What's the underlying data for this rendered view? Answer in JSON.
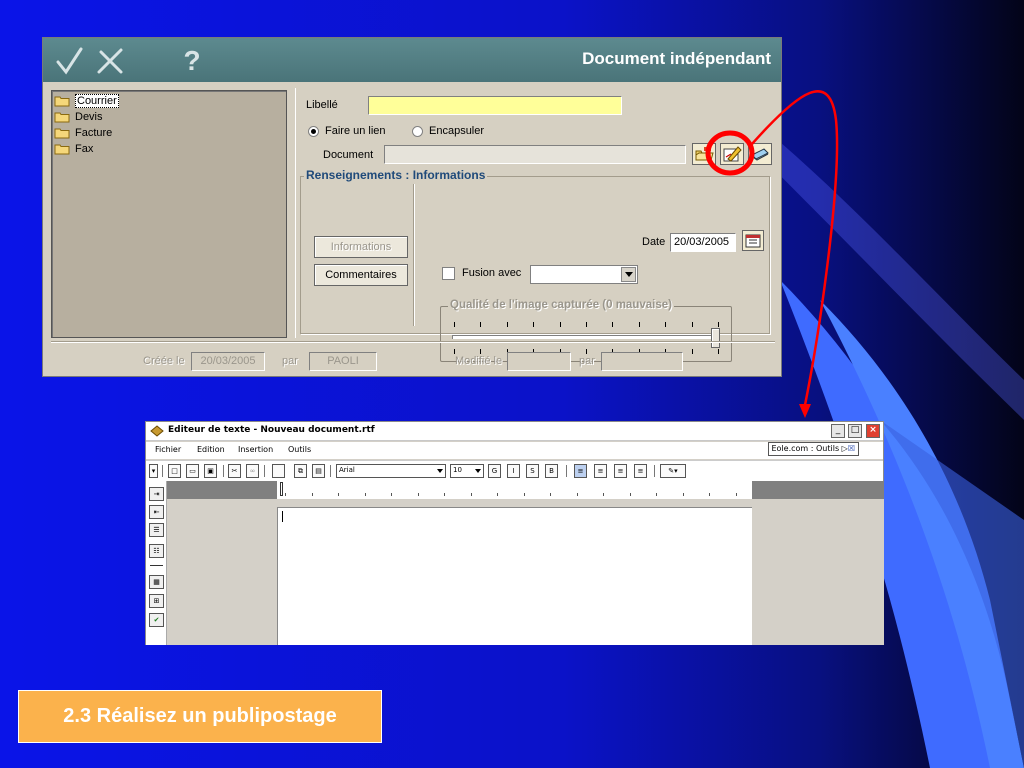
{
  "dialog": {
    "title": "Document indépendant",
    "toolbar": {
      "ok_icon": "checkmark-icon",
      "cancel_icon": "cross-icon",
      "help_label": "?"
    },
    "folders": [
      "Courrier",
      "Devis",
      "Facture",
      "Fax"
    ],
    "selected_folder": "Courrier",
    "libelle_label": "Libellé",
    "libelle_value": "",
    "radio_lien_label": "Faire un lien",
    "radio_encapsuler_label": "Encapsuler",
    "radio_selected": "Faire un lien",
    "document_label": "Document",
    "document_value": "",
    "group_title": "Renseignements : Informations",
    "btn_informations": "Informations",
    "btn_commentaires": "Commentaires",
    "date_label": "Date",
    "date_value": "20/03/2005",
    "fusion_label": "Fusion avec",
    "fusion_value": "",
    "quality_title": "Qualité de l'image capturée (0 mauvaise)",
    "quality_level": 1.0,
    "footer": {
      "cree_label": "Créée le",
      "cree_value": "20/03/2005",
      "par1_label": "par",
      "par1_value": "PAOLI",
      "modifie_label": "Modifié le",
      "modifie_value": "",
      "par2_label": "par",
      "par2_value": ""
    },
    "highlight_color": "#ff0000"
  },
  "editor": {
    "title": "Editeur de texte - Nouveau document.rtf",
    "menu": [
      "Fichier",
      "Edition",
      "Insertion",
      "Outils"
    ],
    "eole_label": "Eole.com : Outils",
    "font_value": "Arial",
    "size_value": "10",
    "format_buttons": [
      "G",
      "I",
      "S",
      "B"
    ]
  },
  "caption": "2.3 Réalisez un publipostage",
  "colors": {
    "background": "#0a14e8",
    "caption_bg": "#fbb24c",
    "dialog_title_bg": "#5d8a8f",
    "libelle_bg": "#ffff99"
  }
}
